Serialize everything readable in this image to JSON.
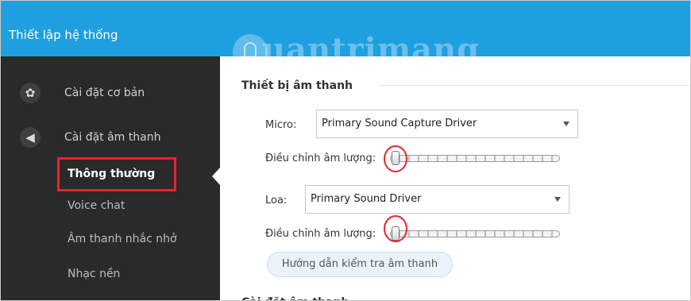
{
  "window": {
    "title": "Thiết lập hệ thống",
    "watermark": "uantrimang"
  },
  "sidebar": {
    "groups": [
      {
        "label": "Cài đặt cơ bản",
        "icon": "gear-icon"
      },
      {
        "label": "Cài đặt âm thanh",
        "icon": "speaker-icon"
      }
    ],
    "subitems": [
      {
        "label": "Thông thường",
        "active": true
      },
      {
        "label": "Voice chat"
      },
      {
        "label": "Âm thanh nhắc nhở"
      },
      {
        "label": "Nhạc nền"
      }
    ]
  },
  "main": {
    "section_heading": "Thiết bị âm thanh",
    "micro": {
      "label": "Micro:",
      "device": "Primary Sound Capture Driver",
      "volume_label": "Điều chỉnh âm lượng:",
      "volume_level": 0
    },
    "speaker": {
      "label": "Loa:",
      "device": "Primary Sound Driver",
      "volume_label": "Điều chỉnh âm lượng:",
      "volume_level": 0
    },
    "test_button": "Hướng dẫn kiểm tra âm thanh",
    "next_section_heading": "Cài đặt âm thanh"
  },
  "colors": {
    "titlebar": "#1e9fe0",
    "sidebar": "#2a2a2a",
    "highlight": "#e8232d"
  }
}
